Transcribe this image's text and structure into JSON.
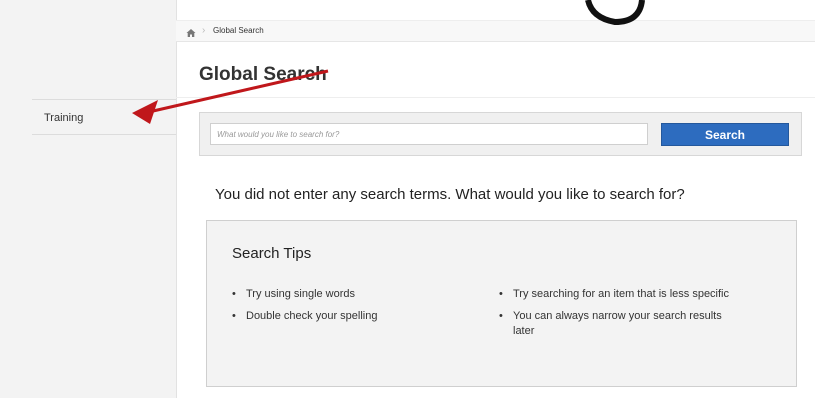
{
  "sidebar": {
    "items": [
      {
        "label": "Training"
      }
    ]
  },
  "breadcrumb": {
    "items": [
      {
        "label": "Global Search"
      }
    ]
  },
  "page": {
    "title": "Global Search"
  },
  "search": {
    "placeholder": "What would you like to search for?",
    "value": "",
    "button_label": "Search"
  },
  "message": "You did not enter any search terms. What would you like to search for?",
  "tips": {
    "title": "Search Tips",
    "left": [
      "Try using single words",
      "Double check your spelling"
    ],
    "right": [
      "Try searching for an item that is less specific",
      "You can always narrow your search results later"
    ]
  },
  "icons": {
    "home": "home-icon"
  },
  "colors": {
    "accent": "#2d6cbf",
    "annotation_arrow": "#c0171b"
  }
}
